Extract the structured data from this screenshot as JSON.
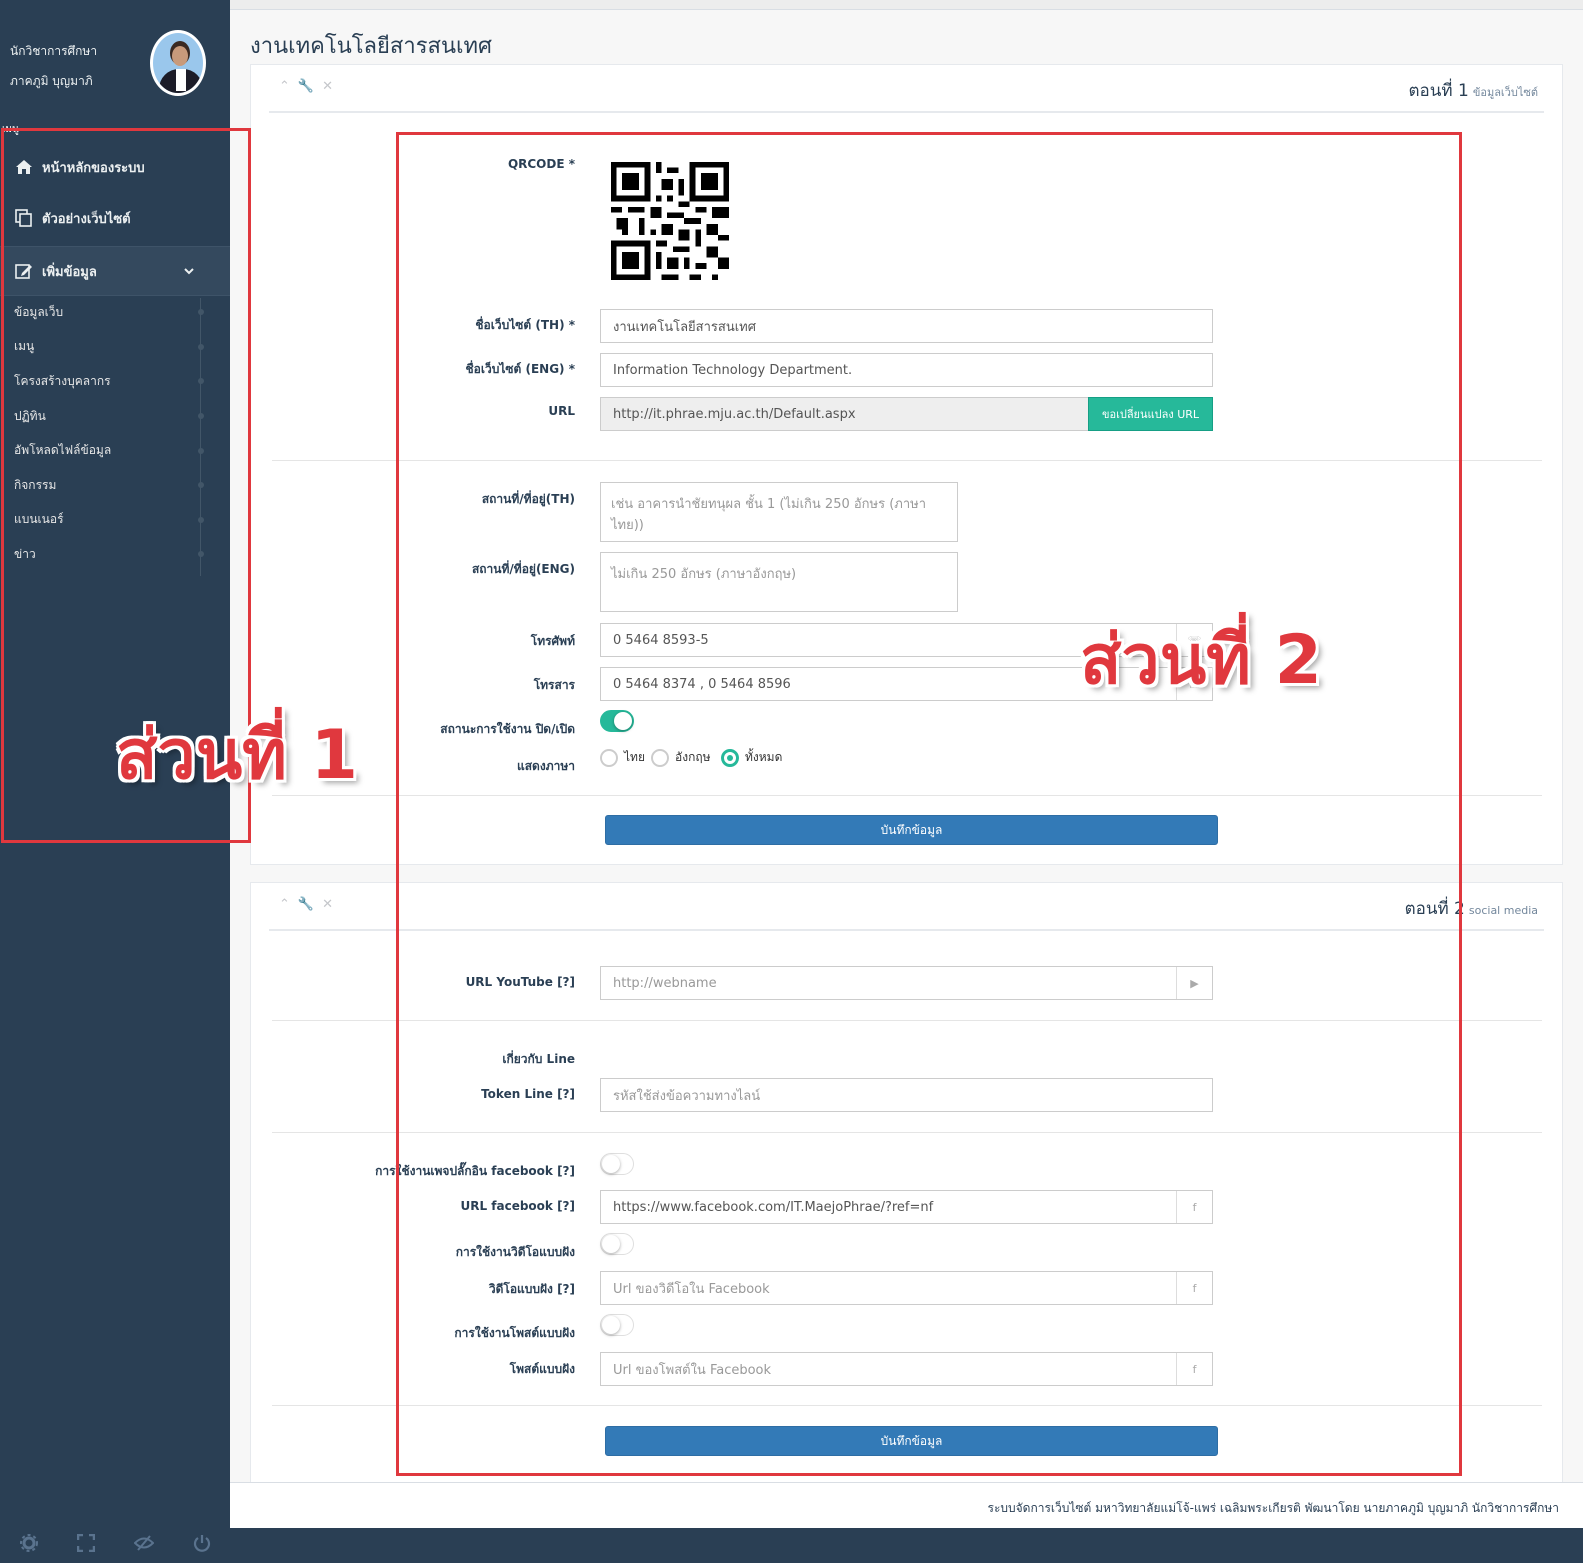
{
  "profile": {
    "role": "นักวิชาการศึกษา",
    "name": "ภาคภูมิ บุญมาภิ"
  },
  "sidebar": {
    "menu_tag": "เมนู",
    "home": "หน้าหลักของระบบ",
    "preview": "ตัวอย่างเว็บไซต์",
    "add": "เพิ่มข้อมูล",
    "sub_items": [
      "ข้อมูลเว็บ",
      "เมนู",
      "โครงสร้างบุคลากร",
      "ปฏิทิน",
      "อัพโหลดไฟล์ข้อมูล",
      "กิจกรรม",
      "แบนเนอร์",
      "ข่าว"
    ]
  },
  "page": {
    "title": "งานเทคโนโลยีสารสนเทศ"
  },
  "panel1": {
    "title": "ตอนที่ 1",
    "subtitle": "ข้อมูลเว็บไซต์",
    "qrcode_label": "QRCODE *",
    "name_th_label": "ชื่อเว็บไซต์ (TH) *",
    "name_th_value": "งานเทคโนโลยีสารสนเทศ",
    "name_en_label": "ชื่อเว็บไซต์ (ENG) *",
    "name_en_value": "Information Technology Department.",
    "url_label": "URL",
    "url_value": "http://it.phrae.mju.ac.th/Default.aspx",
    "url_button": "ขอเปลี่ยนแปลง URL",
    "addr_th_label": "สถานที่/ที่อยู่(TH)",
    "addr_th_placeholder": "เช่น อาคารนำชัยทนุผล ชั้น 1 (ไม่เกิน 250 อักษร (ภาษาไทย))",
    "addr_en_label": "สถานที่/ที่อยู่(ENG)",
    "addr_en_placeholder": "ไม่เกิน 250 อักษร (ภาษาอังกฤษ)",
    "phone_label": "โทรศัพท์",
    "phone_value": "0 5464 8593-5",
    "fax_label": "โทรสาร",
    "fax_value": "0 5464 8374 , 0 5464 8596",
    "status_label": "สถานะการใช้งาน ปิด/เปิด",
    "status_on": true,
    "lang_label": "แสดงภาษา",
    "lang_options": [
      "ไทย",
      "อังกฤษ",
      "ทั้งหมด"
    ],
    "lang_selected": "ทั้งหมด",
    "save": "บันทึกข้อมูล"
  },
  "panel2": {
    "title": "ตอนที่ 2",
    "subtitle": "social media",
    "youtube_label": "URL YouTube [?]",
    "youtube_placeholder": "http://webname",
    "line_heading": "เกี่ยวกับ Line",
    "token_label": "Token Line [?]",
    "token_placeholder": "รหัสใช้ส่งข้อความทางไลน์",
    "fb_plugin_label": "การใช้งานเพจปลั๊กอิน facebook [?]",
    "fb_url_label": "URL facebook [?]",
    "fb_url_value": "https://www.facebook.com/IT.MaejoPhrae/?ref=nf",
    "video_embed_label": "การใช้งานวิดีโอแบบฝัง",
    "video_label": "วิดีโอแบบฝัง [?]",
    "video_placeholder": "Url ของวิดีโอใน Facebook",
    "post_embed_label": "การใช้งานโพสต์แบบฝัง",
    "post_label": "โพสต์แบบฝัง",
    "post_placeholder": "Url ของโพสต์ใน Facebook",
    "save": "บันทึกข้อมูล"
  },
  "annotations": {
    "part1": "ส่วนที่ 1",
    "part2": "ส่วนที่ 2"
  },
  "footer": {
    "text": "ระบบจัดการเว็บไซต์ มหาวิทยาลัยแม่โจ้-แพร่ เฉลิมพระเกียรติ พัฒนาโดย นายภาคภูมิ บุญมาภิ นักวิชาการศึกษา"
  },
  "colors": {
    "sidebar": "#2a3f54",
    "accent": "#26b99a",
    "primary": "#337ab7",
    "annotation": "#e0383e"
  }
}
